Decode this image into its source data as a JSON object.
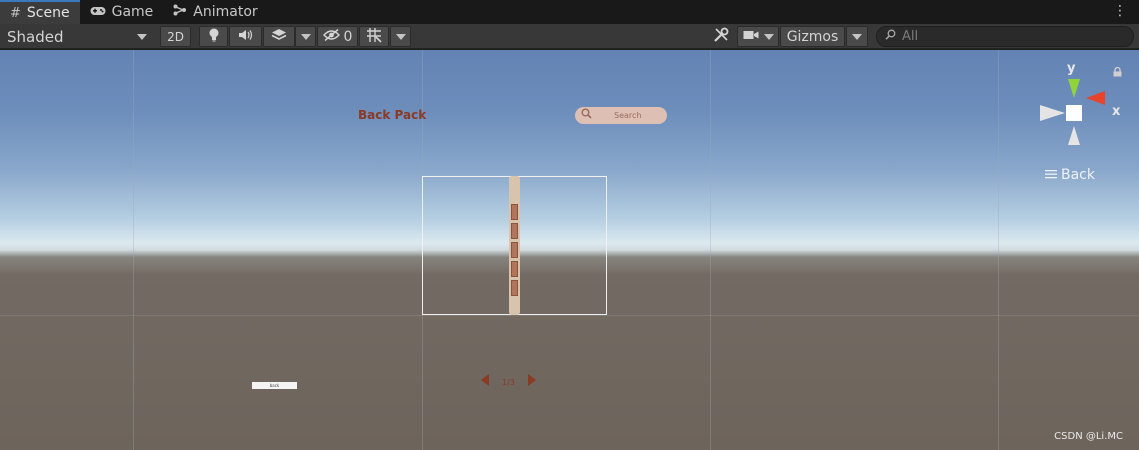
{
  "tabs": [
    {
      "label": "Scene",
      "icon": "grid-icon",
      "active": true
    },
    {
      "label": "Game",
      "icon": "gamepad-icon",
      "active": false
    },
    {
      "label": "Animator",
      "icon": "animator-icon",
      "active": false
    }
  ],
  "toolbar": {
    "shading_mode": "Shaded",
    "mode_2d": "2D",
    "hidden_count": "0",
    "gizmos_label": "Gizmos",
    "search_placeholder": "All"
  },
  "scene": {
    "title_text": "Back Pack",
    "search_label": "Search",
    "page_indicator": "1/3",
    "small_button_label": "back",
    "slot_count": 5
  },
  "gizmo": {
    "axis_y": "y",
    "axis_x": "x",
    "view_label": "Back"
  },
  "watermark": "CSDN @Li.MC",
  "colors": {
    "accent_tab": "#3a79bb",
    "axis_y": "#8fd43a",
    "axis_x": "#e8442c",
    "title_text": "#8a3a25"
  }
}
